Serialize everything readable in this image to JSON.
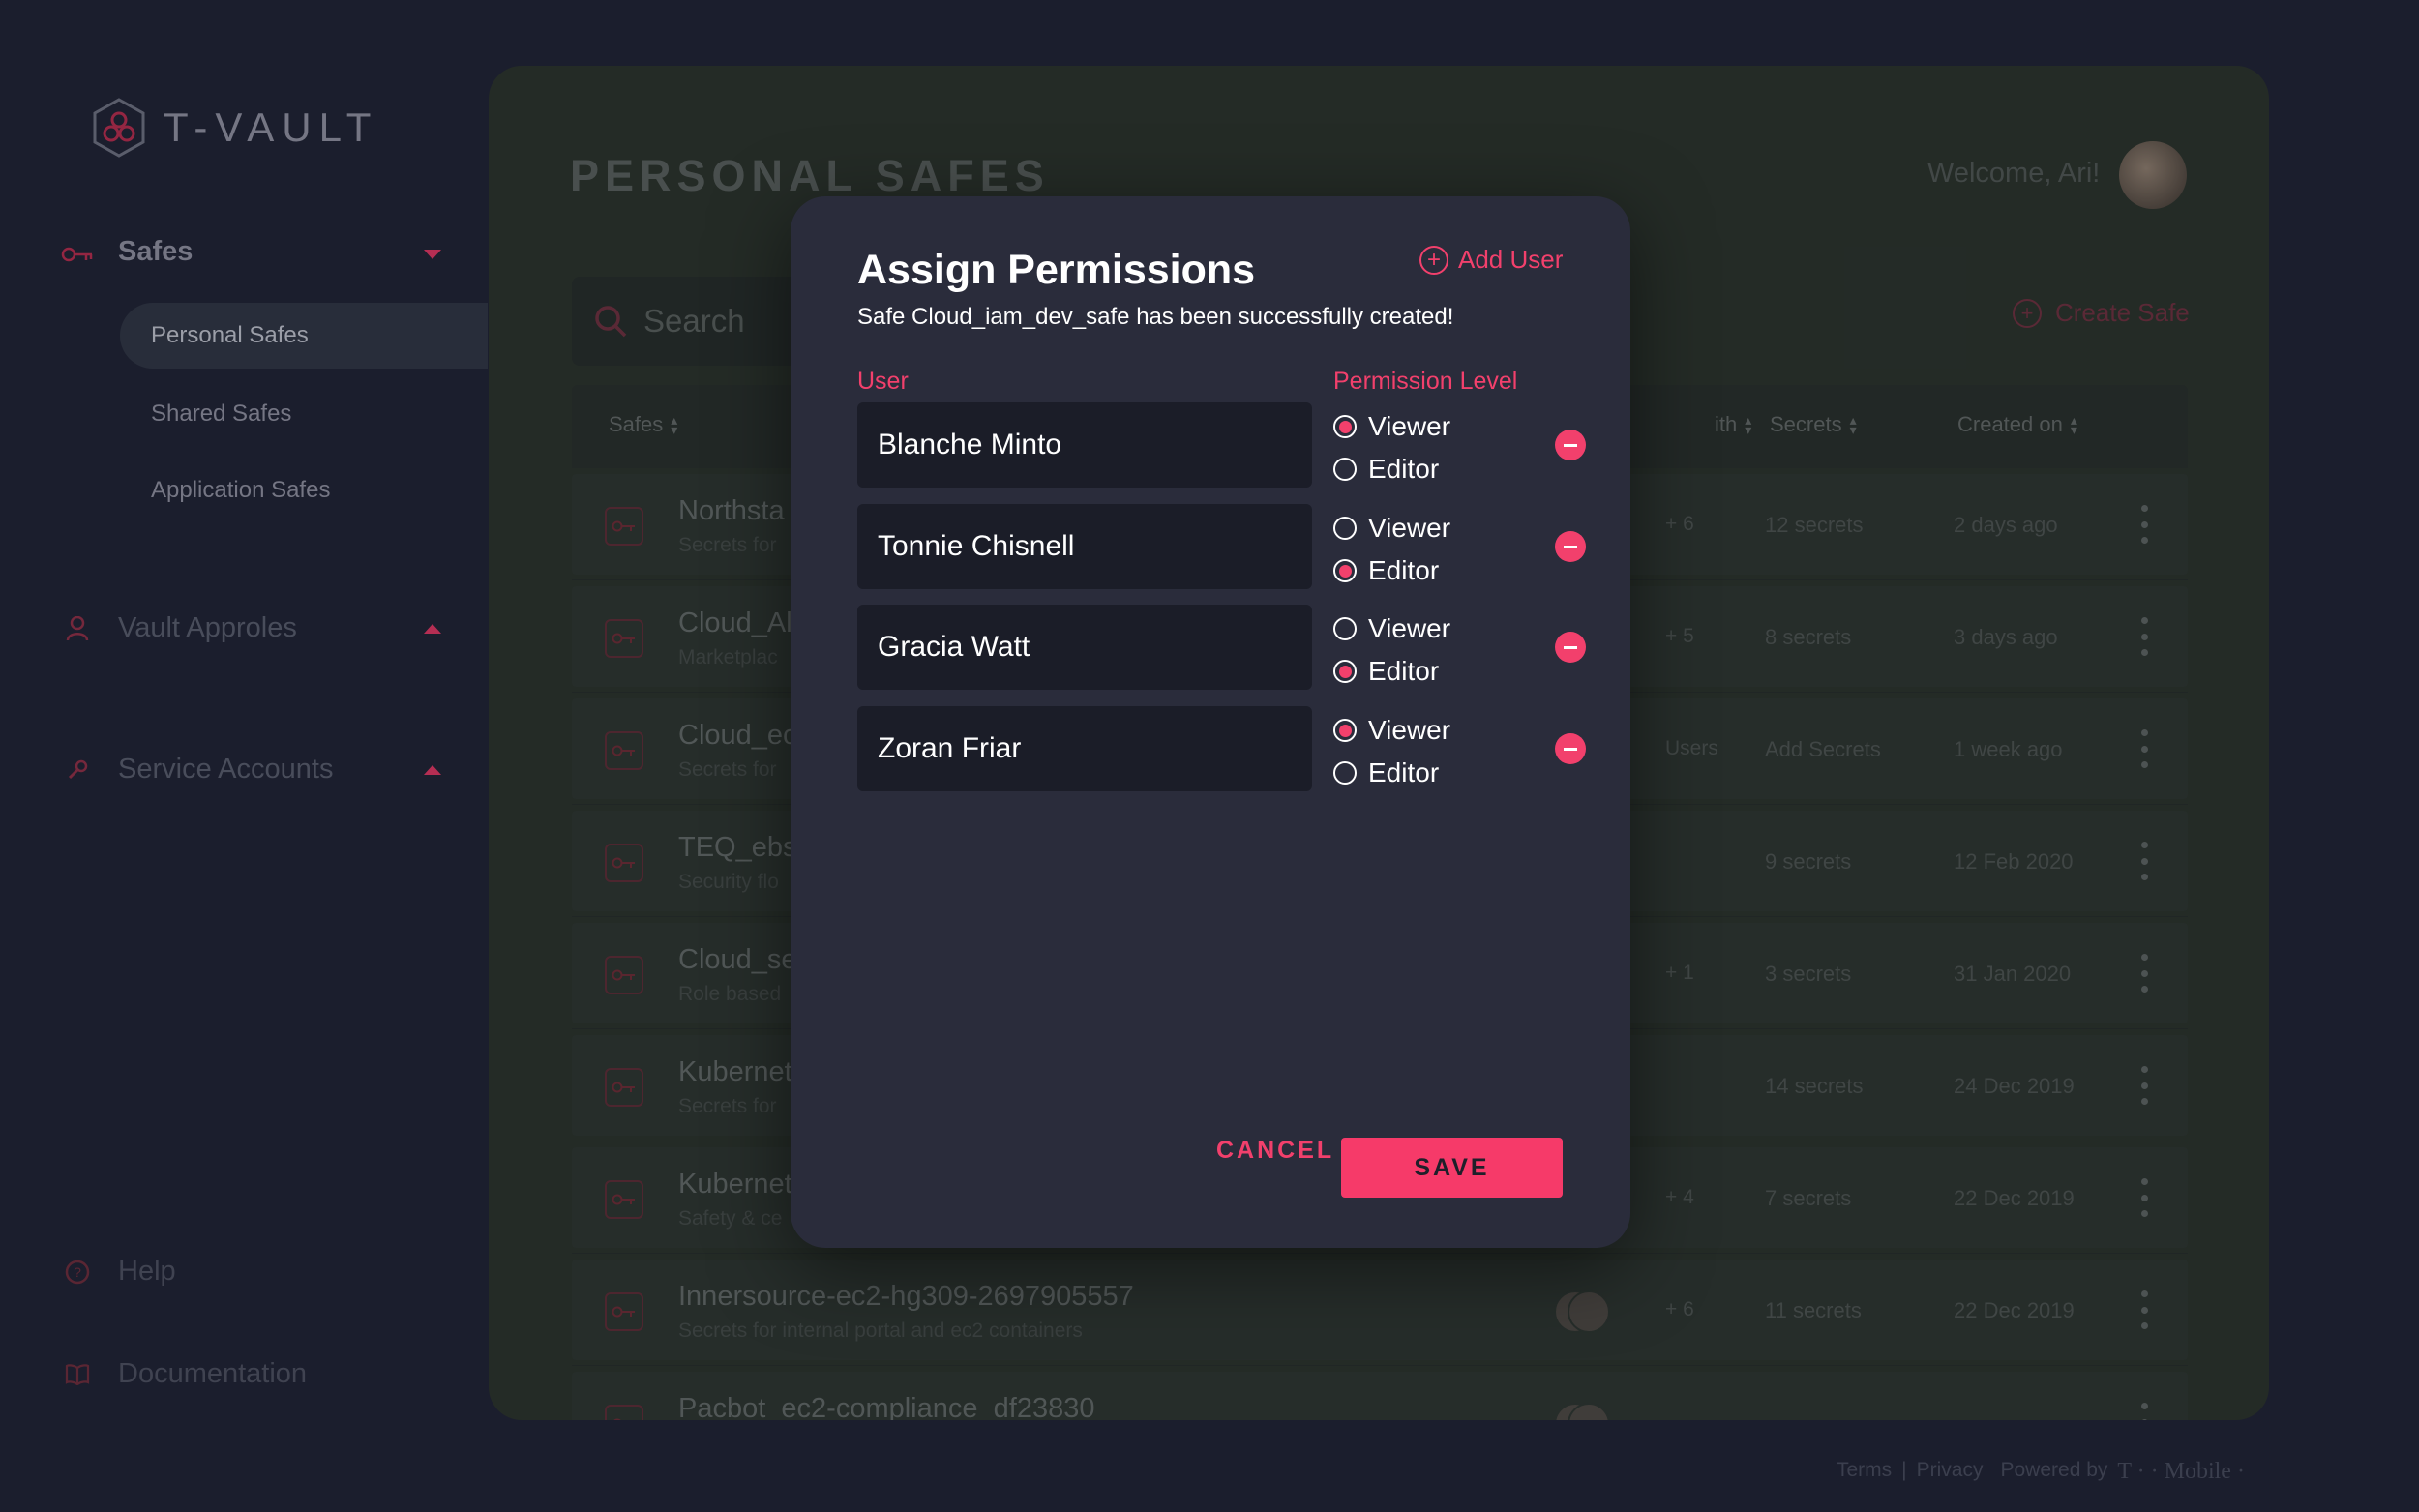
{
  "app": {
    "name": "T-VAULT"
  },
  "sidebar": {
    "safes_label": "Safes",
    "sub_items": [
      "Personal Safes",
      "Shared Safes",
      "Application Safes"
    ],
    "vault_approles_label": "Vault Approles",
    "service_accounts_label": "Service Accounts",
    "help_label": "Help",
    "documentation_label": "Documentation"
  },
  "main": {
    "title": "PERSONAL SAFES",
    "welcome": "Welcome, Ari!",
    "search_placeholder": "Search",
    "create_safe": "Create Safe",
    "columns": {
      "safes": "Safes",
      "shared": "ith",
      "secrets": "Secrets",
      "created": "Created on"
    },
    "rows": [
      {
        "name": "Northsta",
        "desc": "Secrets for",
        "shared": "+ 6",
        "secrets": "12 secrets",
        "date": "2 days ago"
      },
      {
        "name": "Cloud_Al",
        "desc": "Marketplac",
        "shared": "+ 5",
        "secrets": "8 secrets",
        "date": "3 days ago"
      },
      {
        "name": "Cloud_ec",
        "desc": "Secrets for",
        "shared": "Users",
        "secrets": "Add Secrets",
        "date": "1 week ago"
      },
      {
        "name": "TEQ_ebs",
        "desc": "Security flo",
        "shared": "",
        "secrets": "9 secrets",
        "date": "12 Feb 2020"
      },
      {
        "name": "Cloud_se",
        "desc": "Role based",
        "shared": "+ 1",
        "secrets": "3 secrets",
        "date": "31 Jan 2020"
      },
      {
        "name": "Kubernet",
        "desc": "Secrets for",
        "shared": "",
        "secrets": "14 secrets",
        "date": "24 Dec 2019"
      },
      {
        "name": "Kubernet",
        "desc": "Safety & ce",
        "shared": "+ 4",
        "secrets": "7 secrets",
        "date": "22 Dec 2019"
      },
      {
        "name": "Innersource-ec2-hg309-2697905557",
        "desc": "Secrets for internal portal and ec2 containers",
        "shared": "+ 6",
        "secrets": "11 secrets",
        "date": "22 Dec 2019"
      },
      {
        "name": "Pacbot_ec2-compliance_df23830",
        "desc": "",
        "shared": "",
        "secrets": "",
        "date": ""
      }
    ]
  },
  "footer": {
    "terms": "Terms",
    "separator": "|",
    "privacy": "Privacy",
    "powered_by": "Powered by",
    "brand": "T · · Mobile ·"
  },
  "modal": {
    "title": "Assign Permissions",
    "add_user": "Add User",
    "subtitle": "Safe Cloud_iam_dev_safe has been successfully created!",
    "col_user": "User",
    "col_permission": "Permission Level",
    "viewer_label": "Viewer",
    "editor_label": "Editor",
    "users": [
      {
        "name": "Blanche Minto",
        "permission": "Viewer"
      },
      {
        "name": "Tonnie Chisnell",
        "permission": "Editor"
      },
      {
        "name": "Gracia Watt",
        "permission": "Editor"
      },
      {
        "name": "Zoran Friar",
        "permission": "Viewer"
      }
    ],
    "cancel": "CANCEL",
    "save": "SAVE"
  },
  "colors": {
    "accent": "#f2406c",
    "background": "#1d2030",
    "modal": "#2a2c3b",
    "field": "#1b1d28"
  }
}
